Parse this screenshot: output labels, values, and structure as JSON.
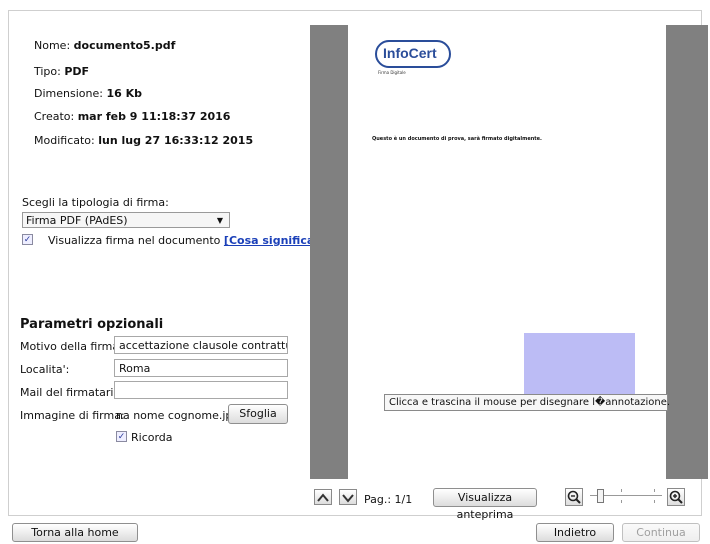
{
  "file": {
    "name_label": "Nome:",
    "name_value": "documento5.pdf",
    "type_label": "Tipo:",
    "type_value": "PDF",
    "size_label": "Dimensione:",
    "size_value": "16 Kb",
    "created_label": "Creato:",
    "created_value": "mar feb 9 11:18:37 2016",
    "modified_label": "Modificato:",
    "modified_value": "lun lug 27 16:33:12 2015"
  },
  "signature": {
    "type_label": "Scegli la tipologia di firma:",
    "type_selected": "Firma PDF (PAdES)",
    "show_in_doc_label": "Visualizza firma nel documento",
    "show_in_doc_checked": true,
    "what_link": "[Cosa significa?]"
  },
  "optional": {
    "title": "Parametri opzionali",
    "reason_label": "Motivo della firma:",
    "reason_value": "accettazione clausole contrattuali",
    "location_label": "Localita':",
    "location_value": "Roma",
    "mail_label": "Mail del firmatario:",
    "mail_value": "",
    "image_label": "Immagine di firma:",
    "image_value": "na nome cognome.jpg",
    "browse_label": "Sfoglia",
    "remember_label": "Ricorda",
    "remember_checked": true
  },
  "preview": {
    "logo_text": "InfoCert",
    "logo_subtitle": "Firma Digitale",
    "doc_text": "Questo è un documento di prova, sarà firmato digitalmente.",
    "tooltip": "Clicca e trascina il mouse per disegnare l�annotazione.",
    "page_indicator": "Pag.: 1/1",
    "preview_button": "Visualizza anteprima",
    "zoom_level": 0.1
  },
  "footer": {
    "home_button": "Torna alla home",
    "back_button": "Indietro",
    "continue_button": "Continua"
  },
  "colors": {
    "viewer_bg": "#808080",
    "signature_box": "#bcbcf5",
    "link": "#1a3fb8",
    "logo": "#2a4d9a"
  }
}
